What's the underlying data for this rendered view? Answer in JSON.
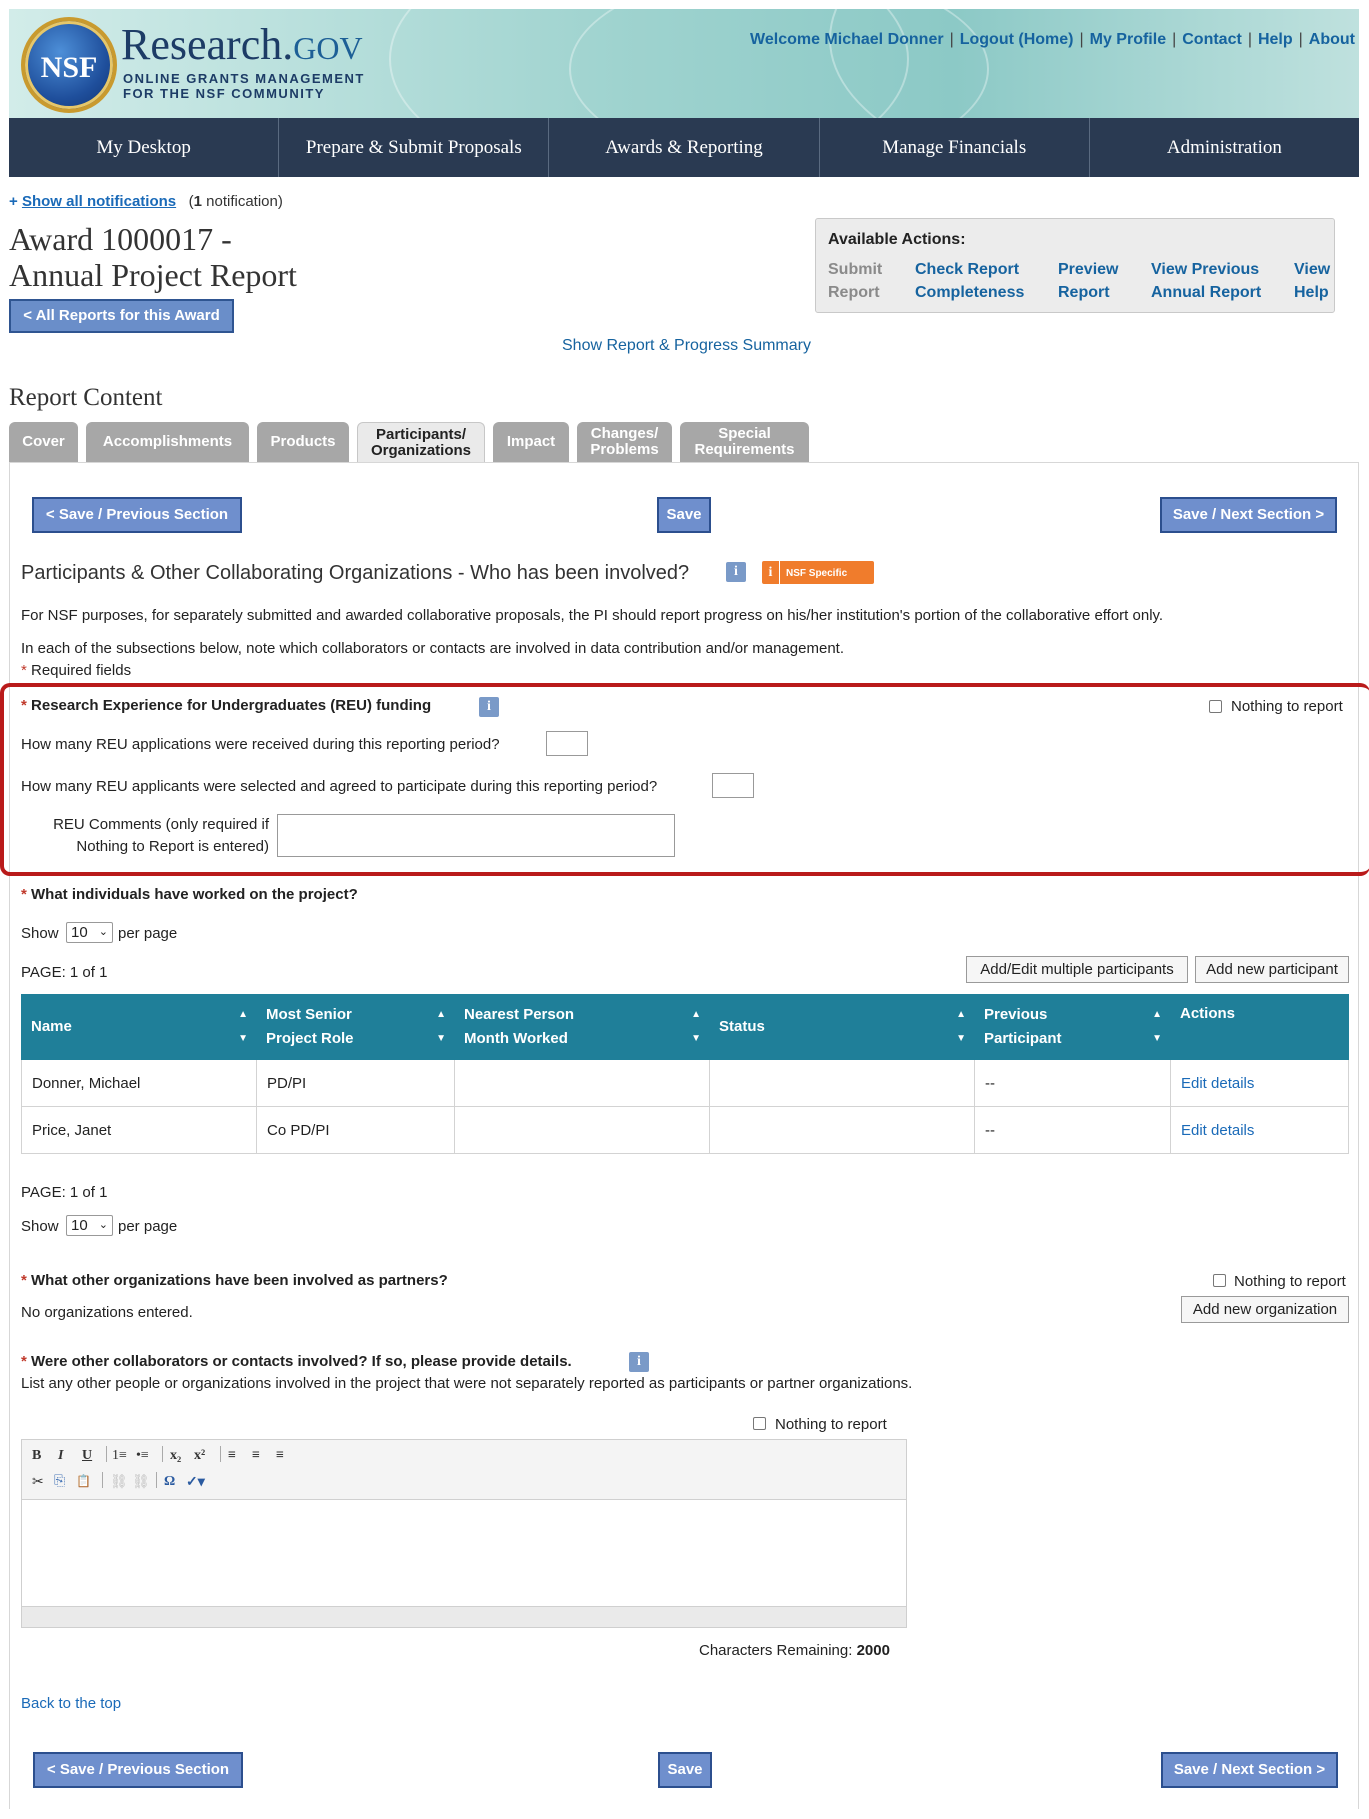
{
  "header": {
    "seal_text": "NSF",
    "site_name": "Research.",
    "site_tld": "GOV",
    "tagline_line1": "ONLINE GRANTS MANAGEMENT",
    "tagline_line2": "FOR THE NSF COMMUNITY",
    "top_links": [
      "Welcome Michael Donner",
      "Logout (Home)",
      "My Profile",
      "Contact",
      "Help",
      "About"
    ]
  },
  "nav": [
    "My Desktop",
    "Prepare & Submit Proposals",
    "Awards & Reporting",
    "Manage Financials",
    "Administration"
  ],
  "notifications": {
    "plus": "+",
    "link": "Show all notifications",
    "count_prefix": "(",
    "count": "1",
    "count_suffix": " notification)"
  },
  "award": {
    "title_line1": "Award 1000017 -",
    "title_line2": "Annual Project Report",
    "all_reports_button": "< All Reports for this Award"
  },
  "available_actions": {
    "label": "Available Actions:",
    "items": [
      {
        "line1": "Submit",
        "line2": "Report",
        "enabled": false
      },
      {
        "line1": "Check Report",
        "line2": "Completeness",
        "enabled": true
      },
      {
        "line1": "Preview",
        "line2": "Report",
        "enabled": true
      },
      {
        "line1": "View Previous",
        "line2": "Annual Report",
        "enabled": true
      },
      {
        "line1": "View",
        "line2": "Help",
        "enabled": true
      }
    ]
  },
  "show_summary_link": "Show Report & Progress Summary",
  "report_content_heading": "Report Content",
  "tabs": [
    {
      "line1": "Cover",
      "line2": ""
    },
    {
      "line1": "Accomplishments",
      "line2": ""
    },
    {
      "line1": "Products",
      "line2": ""
    },
    {
      "line1": "Participants/",
      "line2": "Organizations"
    },
    {
      "line1": "Impact",
      "line2": ""
    },
    {
      "line1": "Changes/",
      "line2": "Problems"
    },
    {
      "line1": "Special",
      "line2": "Requirements"
    }
  ],
  "buttons": {
    "prev": "< Save / Previous Section",
    "save": "Save",
    "next": "Save / Next Section >"
  },
  "section": {
    "title": "Participants & Other Collaborating Organizations - Who has been involved?",
    "info_glyph": "i",
    "nsf_specific": "NSF Specific",
    "para1": "For NSF purposes, for separately submitted and awarded collaborative proposals, the PI should report progress on his/her institution's portion of the collaborative effort only.",
    "para2": "In each of the subsections below, note which collaborators or contacts are involved in data contribution and/or management.",
    "required_star": "*",
    "required_note": " Required fields"
  },
  "reu": {
    "title": "Research Experience for Undergraduates (REU) funding",
    "nothing_to_report": "Nothing to report",
    "q1": "How many REU applications were received during this reporting period?",
    "q1_value": "",
    "q2": "How many REU applicants were selected and agreed to participate during this reporting period?",
    "q2_value": "",
    "comments_label_line1": "REU Comments (only required if",
    "comments_label_line2": "Nothing to Report is entered)",
    "comments_value": ""
  },
  "participants": {
    "title": "What individuals have worked on the project?",
    "show": "Show",
    "per_page_value": "10",
    "per_page": "per page",
    "page": "PAGE: 1 of 1",
    "add_multiple": "Add/Edit multiple participants",
    "add_new": "Add new participant",
    "columns": [
      {
        "line1": "Name",
        "line2": ""
      },
      {
        "line1": "Most Senior",
        "line2": "Project Role"
      },
      {
        "line1": "Nearest Person",
        "line2": "Month Worked"
      },
      {
        "line1": "Status",
        "line2": ""
      },
      {
        "line1": "Previous",
        "line2": "Participant"
      },
      {
        "line1": "Actions",
        "line2": ""
      }
    ],
    "rows": [
      {
        "name": "Donner, Michael",
        "role": "PD/PI",
        "month": "",
        "status": "",
        "previous": "--",
        "action": "Edit details"
      },
      {
        "name": "Price, Janet",
        "role": "Co PD/PI",
        "month": "",
        "status": "",
        "previous": "--",
        "action": "Edit details"
      }
    ]
  },
  "organizations": {
    "title": "What other organizations have been involved as partners?",
    "nothing_to_report": "Nothing to report",
    "empty": "No organizations entered.",
    "add_button": "Add new organization"
  },
  "collaborators": {
    "title": "Were other collaborators or contacts involved? If so, please provide details.",
    "desc": "List any other people or organizations involved in the project that were not separately reported as participants or partner organizations.",
    "nothing_to_report": "Nothing to report",
    "chars_label": "Characters Remaining: ",
    "chars_value": "2000",
    "toolbar_row1": [
      "B",
      "I",
      "U",
      "1≡",
      "•≡",
      "x₂",
      "x²",
      "≡",
      "≡",
      "≡"
    ],
    "toolbar_row2": [
      "✂",
      "⎘",
      "📋",
      "⛓",
      "⛓",
      "Ω",
      "✓▾"
    ]
  },
  "back_to_top": "Back to the top"
}
